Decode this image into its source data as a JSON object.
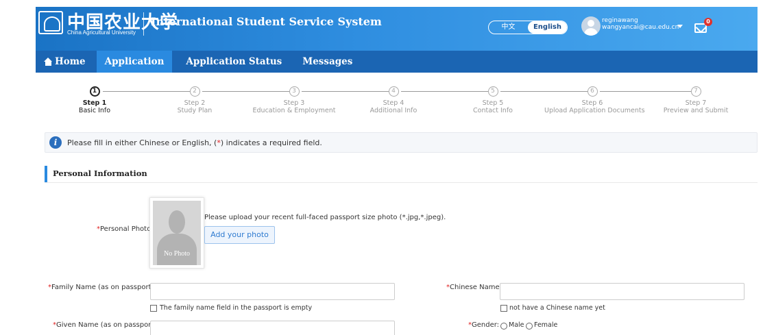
{
  "brand": {
    "logo_cn": "中国农业大学",
    "logo_en": "China Agricultural University",
    "system_title": "International Student Service System"
  },
  "lang": {
    "zh": "中文",
    "en": "English",
    "selected": "English"
  },
  "user": {
    "name": "reginawang",
    "email": "wangyancai@cau.edu.cn"
  },
  "messages": {
    "unread": "0"
  },
  "nav": {
    "home": "Home",
    "application": "Application",
    "status": "Application Status",
    "messages": "Messages",
    "active": "Application"
  },
  "steps": [
    {
      "num": "1",
      "title": "Step 1",
      "sub": "Basic Info",
      "active": true
    },
    {
      "num": "2",
      "title": "Step 2",
      "sub": "Study Plan",
      "active": false
    },
    {
      "num": "3",
      "title": "Step 3",
      "sub": "Education & Employment",
      "active": false
    },
    {
      "num": "4",
      "title": "Step 4",
      "sub": "Additional Info",
      "active": false
    },
    {
      "num": "5",
      "title": "Step 5",
      "sub": "Contact Info",
      "active": false
    },
    {
      "num": "6",
      "title": "Step 6",
      "sub": "Upload Application Documents",
      "active": false
    },
    {
      "num": "7",
      "title": "Step 7",
      "sub": "Preview and Submit",
      "active": false
    }
  ],
  "notice": {
    "before": "Please fill in either Chinese or English, (",
    "mark": "*",
    "after": ") indicates a required field."
  },
  "section": {
    "title": "Personal Information"
  },
  "form": {
    "required_mark": "*",
    "photo": {
      "label": "Personal Photo",
      "placeholder_text": "No Photo",
      "hint": "Please upload your recent full-faced passport size photo (*.jpg,*.jpeg).",
      "button": "Add your photo"
    },
    "family_name": {
      "label": "Family Name (as on passport) :",
      "value": "",
      "checkbox_label": "The family name field in the passport is empty",
      "checked": false
    },
    "chinese_name": {
      "label": "Chinese Name:",
      "value": "",
      "checkbox_label": "not have a Chinese name yet",
      "checked": false
    },
    "given_name": {
      "label": "Given Name (as on passport):",
      "value": ""
    },
    "gender": {
      "label": "Gender:",
      "options": [
        "Male",
        "Female"
      ],
      "selected": null
    }
  }
}
